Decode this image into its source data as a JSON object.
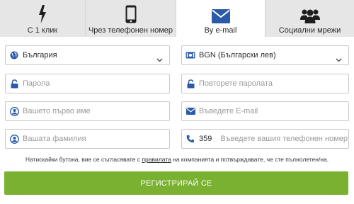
{
  "tabs": [
    {
      "label": "С 1 клик",
      "icon": "lightning-icon",
      "active": false
    },
    {
      "label": "Чрез телефонен номер",
      "icon": "mobile-phone-icon",
      "active": false
    },
    {
      "label": "By e-mail",
      "icon": "envelope-icon",
      "active": true
    },
    {
      "label": "Социални мрежи",
      "icon": "users-icon",
      "active": false
    }
  ],
  "form": {
    "country": {
      "value": "България",
      "icon": "globe-icon"
    },
    "currency": {
      "value": "BGN (Български лев)",
      "icon": "money-icon"
    },
    "password": {
      "placeholder": "Парола",
      "icon": "lock-icon"
    },
    "password_repeat": {
      "placeholder": "Повторете паролата",
      "icon": "lock-icon"
    },
    "first_name": {
      "placeholder": "Вашето първо име",
      "icon": "user-icon"
    },
    "email": {
      "placeholder": "Въведете E-mail",
      "icon": "envelope-icon"
    },
    "last_name": {
      "placeholder": "Вашата фамилия",
      "icon": "user-icon"
    },
    "phone": {
      "code": "359",
      "placeholder": "Въведете вашия телефонен номер",
      "icon": "phone-icon"
    }
  },
  "terms": {
    "before": "Натискайки бутона, вие се съгласявате с ",
    "link": "правилата",
    "after": " на компанията и потвърждавате, че сте пълнолетен/на."
  },
  "submit_label": "РЕГИСТРИРАЙ СЕ",
  "colors": {
    "accent": "#2a5aa8",
    "button": "#7ab131",
    "tab_bg": "#e6e6e6",
    "border": "#c9c9c9"
  }
}
